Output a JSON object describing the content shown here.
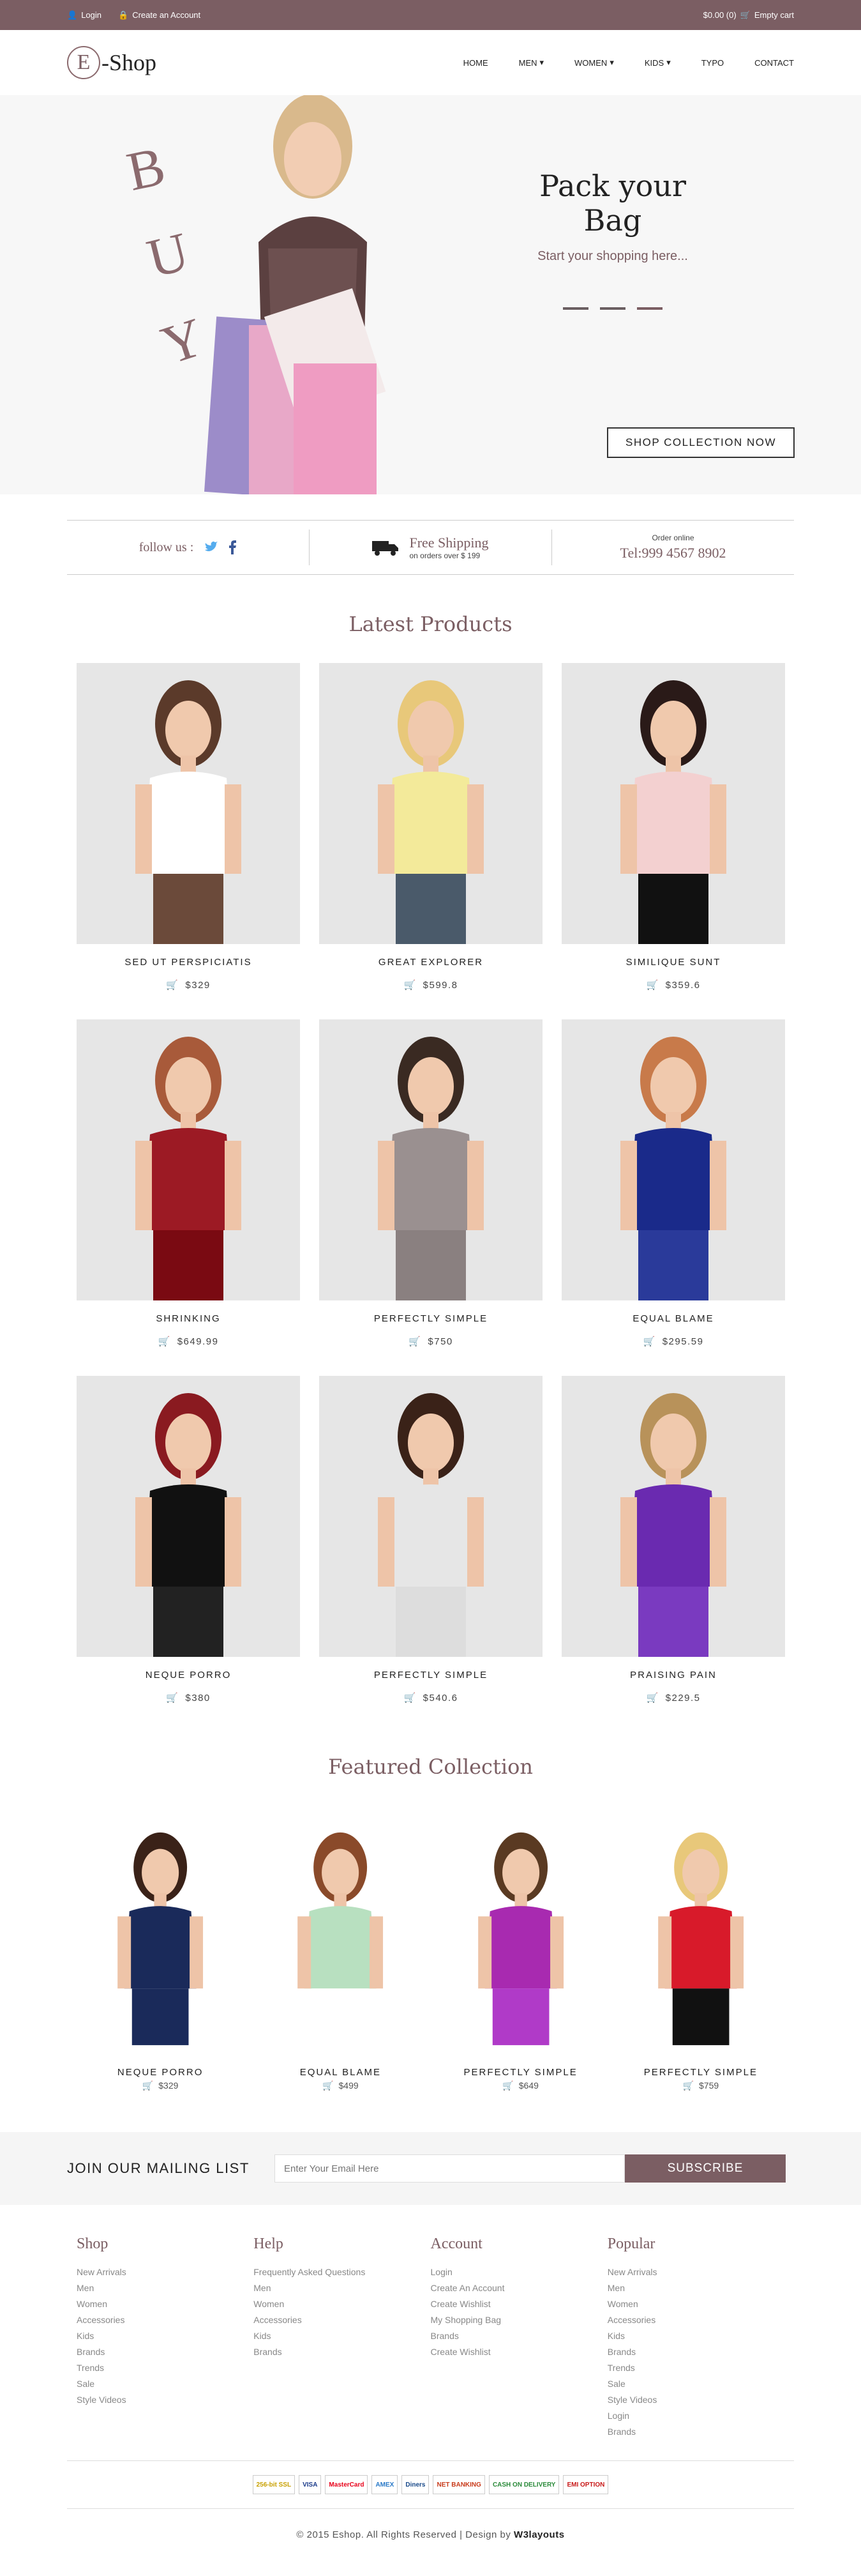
{
  "topbar": {
    "login": "Login",
    "create": "Create an Account",
    "cart_total": "$0.00 (0)",
    "cart_label": "Empty cart"
  },
  "header": {
    "logo_letter": "E",
    "logo_text": "-Shop",
    "nav": [
      "HOME",
      "MEN",
      "WOMEN",
      "KIDS",
      "TYPO",
      "CONTACT"
    ]
  },
  "hero": {
    "buy": [
      "B",
      "U",
      "Y"
    ],
    "title": "Pack your Bag",
    "subtitle": "Start your shopping here...",
    "cta": "SHOP COLLECTION NOW"
  },
  "info": {
    "follow": "follow us :",
    "ship_title": "Free Shipping",
    "ship_sub": "on orders over $ 199",
    "order_label": "Order online",
    "phone": "Tel:999 4567 8902"
  },
  "latest": {
    "title": "Latest Products",
    "products": [
      {
        "name": "SED UT PERSPICIATIS",
        "price": "$329"
      },
      {
        "name": "GREAT EXPLORER",
        "price": "$599.8"
      },
      {
        "name": "SIMILIQUE SUNT",
        "price": "$359.6"
      },
      {
        "name": "SHRINKING",
        "price": "$649.99"
      },
      {
        "name": "PERFECTLY SIMPLE",
        "price": "$750"
      },
      {
        "name": "EQUAL BLAME",
        "price": "$295.59"
      },
      {
        "name": "NEQUE PORRO",
        "price": "$380"
      },
      {
        "name": "PERFECTLY SIMPLE",
        "price": "$540.6"
      },
      {
        "name": "PRAISING PAIN",
        "price": "$229.5"
      }
    ]
  },
  "featured": {
    "title": "Featured Collection",
    "items": [
      {
        "name": "NEQUE PORRO",
        "price": "$329"
      },
      {
        "name": "EQUAL BLAME",
        "price": "$499"
      },
      {
        "name": "PERFECTLY SIMPLE",
        "price": "$649"
      },
      {
        "name": "PERFECTLY SIMPLE",
        "price": "$759"
      }
    ]
  },
  "mailing": {
    "title": "JOIN OUR MAILING LIST",
    "placeholder": "Enter Your Email Here",
    "button": "SUBSCRIBE"
  },
  "footer": {
    "cols": [
      {
        "title": "Shop",
        "links": [
          "New Arrivals",
          "Men",
          "Women",
          "Accessories",
          "Kids",
          "Brands",
          "Trends",
          "Sale",
          "Style Videos"
        ]
      },
      {
        "title": "Help",
        "links": [
          "Frequently Asked Questions",
          "Men",
          "Women",
          "Accessories",
          "Kids",
          "Brands"
        ]
      },
      {
        "title": "Account",
        "links": [
          "Login",
          "Create An Account",
          "Create Wishlist",
          "My Shopping Bag",
          "Brands",
          "Create Wishlist"
        ]
      },
      {
        "title": "Popular",
        "links": [
          "New Arrivals",
          "Men",
          "Women",
          "Accessories",
          "Kids",
          "Brands",
          "Trends",
          "Sale",
          "Style Videos",
          "Login",
          "Brands"
        ]
      }
    ]
  },
  "payments": [
    "256-bit SSL",
    "VISA",
    "MasterCard",
    "AMEX",
    "Diners",
    "NET BANKING",
    "CASH ON DELIVERY",
    "EMI OPTION"
  ],
  "copyright": {
    "text": "© 2015 Eshop. All Rights Reserved | Design by ",
    "brand": "W3layouts"
  },
  "colors": {
    "brand": "#7b5e63"
  }
}
